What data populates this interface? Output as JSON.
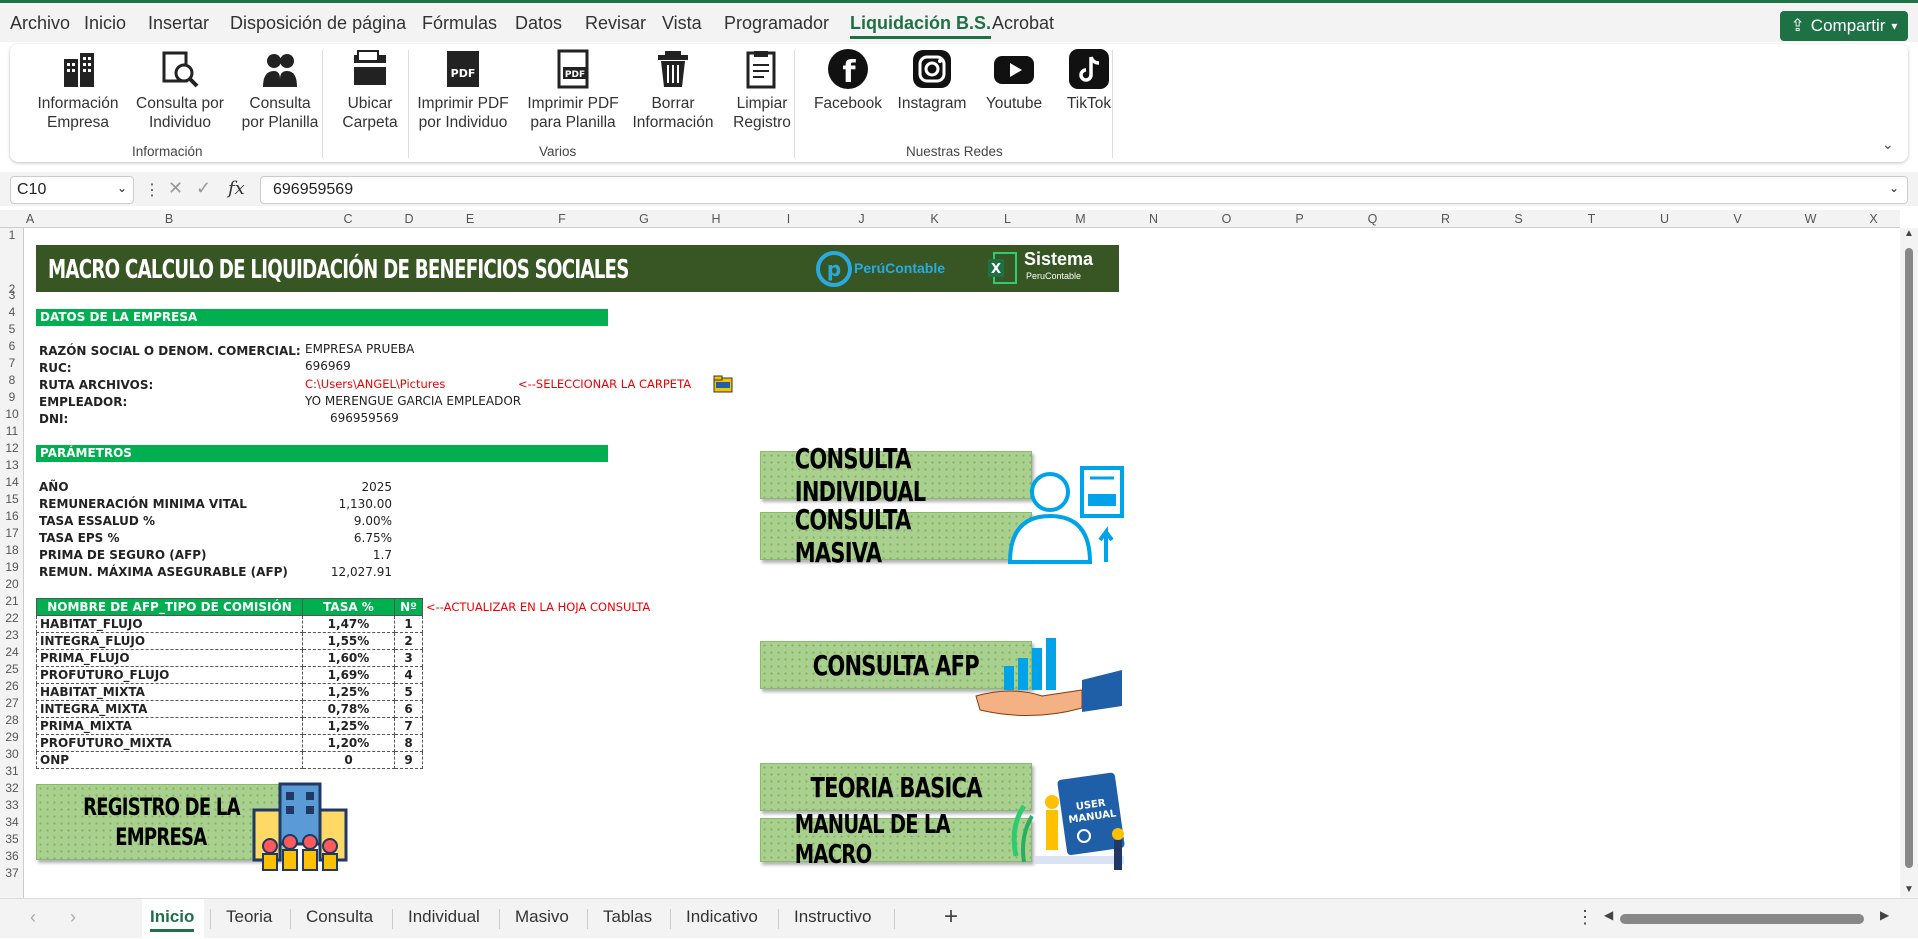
{
  "menu": {
    "items": [
      "Archivo",
      "Inicio",
      "Insertar",
      "Disposición de página",
      "Fórmulas",
      "Datos",
      "Revisar",
      "Vista",
      "Programador",
      "Liquidación B.S.",
      "Acrobat"
    ],
    "active": "Liquidación B.S.",
    "share_label": "Compartir"
  },
  "ribbon": {
    "buttons": [
      {
        "line1": "Información",
        "line2": "Empresa"
      },
      {
        "line1": "Consulta por",
        "line2": "Individuo"
      },
      {
        "line1": "Consulta",
        "line2": "por Planilla"
      },
      {
        "line1": "Ubicar",
        "line2": "Carpeta"
      },
      {
        "line1": "Imprimir PDF",
        "line2": "por Individuo"
      },
      {
        "line1": "Imprimir PDF",
        "line2": "para Planilla"
      },
      {
        "line1": "Borrar",
        "line2": "Información"
      },
      {
        "line1": "Limpiar",
        "line2": "Registro"
      },
      {
        "line1": "Facebook",
        "line2": ""
      },
      {
        "line1": "Instagram",
        "line2": ""
      },
      {
        "line1": "Youtube",
        "line2": ""
      },
      {
        "line1": "TikTok",
        "line2": ""
      }
    ],
    "groups": [
      "Información",
      "Varios",
      "Nuestras Redes"
    ],
    "pdf_icon_text": "PDF"
  },
  "formula_bar": {
    "name_box": "C10",
    "formula": "696959569",
    "fx": "fx"
  },
  "columns": [
    "A",
    "B",
    "C",
    "D",
    "E",
    "F",
    "G",
    "H",
    "I",
    "J",
    "K",
    "L",
    "M",
    "N",
    "O",
    "P",
    "Q",
    "R",
    "S",
    "T",
    "U",
    "V",
    "W",
    "X"
  ],
  "rows": [
    "1",
    "2",
    "3",
    "4",
    "5",
    "6",
    "7",
    "8",
    "9",
    "10",
    "11",
    "12",
    "13",
    "14",
    "15",
    "16",
    "17",
    "18",
    "19",
    "20",
    "21",
    "22",
    "23",
    "24",
    "25",
    "26",
    "27",
    "28",
    "29",
    "30",
    "31",
    "32",
    "33",
    "34",
    "35",
    "36",
    "37"
  ],
  "sheet": {
    "banner_title": "MACRO CALCULO DE LIQUIDACIÓN DE BENEFICIOS SOCIALES",
    "logo1": "PerúContable",
    "logo2_title": "Sistema",
    "logo2_sub": "PeruContable",
    "section_empresa": "DATOS DE LA EMPRESA",
    "empresa": [
      {
        "label": "RAZÓN SOCIAL O DENOM. COMERCIAL:",
        "value": "EMPRESA PRUEBA"
      },
      {
        "label": "RUC:",
        "value": "696969"
      },
      {
        "label": "RUTA ARCHIVOS:",
        "value": "C:\\Users\\ANGEL\\Pictures"
      },
      {
        "label": "EMPLEADOR:",
        "value": "YO MERENGUE GARCIA EMPLEADOR"
      },
      {
        "label": "DNI:",
        "value": "696959569"
      }
    ],
    "folder_note": "<--SELECCIONAR LA CARPETA",
    "section_parametros": "PARÁMETROS",
    "parametros": [
      {
        "label": "AÑO",
        "value": "2025"
      },
      {
        "label": "REMUNERACIÓN MINIMA VITAL",
        "value": "1,130.00"
      },
      {
        "label": "TASA ESSALUD %",
        "value": "9.00%"
      },
      {
        "label": "TASA EPS %",
        "value": "6.75%"
      },
      {
        "label": "PRIMA DE SEGURO (AFP)",
        "value": "1.7"
      },
      {
        "label": "REMUN. MÁXIMA ASEGURABLE (AFP)",
        "value": "12,027.91"
      }
    ],
    "afp_headers": [
      "NOMBRE DE AFP_TIPO DE COMISIÓN",
      "TASA %",
      "Nº"
    ],
    "afp_note": "<--ACTUALIZAR EN LA HOJA CONSULTA",
    "afp_rows": [
      {
        "name": "HABITAT_FLUJO",
        "rate": "1,47%",
        "n": "1"
      },
      {
        "name": "INTEGRA_FLUJO",
        "rate": "1,55%",
        "n": "2"
      },
      {
        "name": "PRIMA_FLUJO",
        "rate": "1,60%",
        "n": "3"
      },
      {
        "name": "PROFUTURO_FLUJO",
        "rate": "1,69%",
        "n": "4"
      },
      {
        "name": "HABITAT_MIXTA",
        "rate": "1,25%",
        "n": "5"
      },
      {
        "name": "INTEGRA_MIXTA",
        "rate": "0,78%",
        "n": "6"
      },
      {
        "name": "PRIMA_MIXTA",
        "rate": "1,25%",
        "n": "7"
      },
      {
        "name": "PROFUTURO_MIXTA",
        "rate": "1,20%",
        "n": "8"
      },
      {
        "name": "ONP",
        "rate": "0",
        "n": "9"
      }
    ],
    "buttons": {
      "registro_l1": "REGISTRO DE LA",
      "registro_l2": "EMPRESA",
      "consulta_individual": "CONSULTA INDIVIDUAL",
      "consulta_masiva": "CONSULTA MASIVA",
      "consulta_afp": "CONSULTA AFP",
      "teoria_basica": "TEORIA BASICA",
      "manual_macro": "MANUAL DE LA MACRO",
      "user_manual": "USER MANUAL"
    }
  },
  "tabs": {
    "items": [
      "Inicio",
      "Teoria",
      "Consulta",
      "Individual",
      "Masivo",
      "Tablas",
      "Indicativo",
      "Instructivo"
    ],
    "active": "Inicio",
    "add": "+"
  },
  "colors": {
    "accent": "#1e7145",
    "banner": "#375623",
    "section": "#00b050",
    "button": "#a9d08e"
  }
}
